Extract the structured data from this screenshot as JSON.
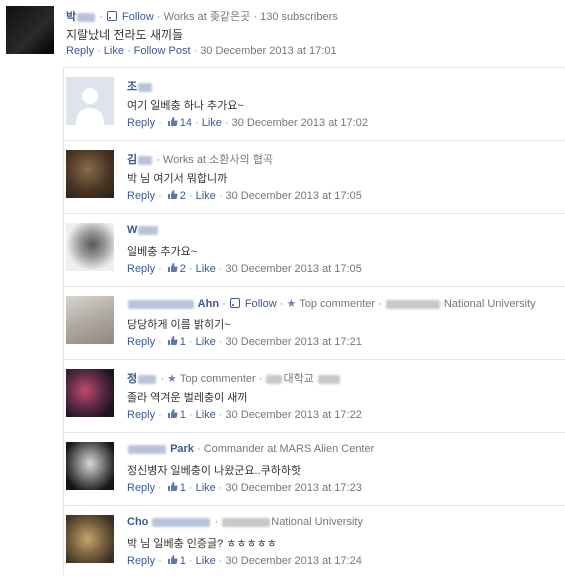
{
  "post": {
    "author_prefix": "박",
    "follow_label": "Follow",
    "work_info": "· Works at 좆같은곳 ·",
    "subscribers": "130 subscribers",
    "text": "지랄났네 전라도 새끼들",
    "actions": {
      "reply": "Reply",
      "like": "Like",
      "follow_post": "Follow Post",
      "timestamp": "30 December 2013 at 17:01"
    }
  },
  "replies": [
    {
      "name_prefix": "조",
      "name_suffix": "",
      "info": "",
      "text": "여기 일베충 하나 추가요~",
      "reply": "Reply",
      "likes": "14",
      "like": "Like",
      "timestamp": "30 December 2013 at 17:02"
    },
    {
      "name_prefix": "김",
      "name_suffix": "",
      "info": "· Works at 소환사의 협곡",
      "text": "박      님 여기서 뭐합니까",
      "reply": "Reply",
      "likes": "2",
      "like": "Like",
      "timestamp": "30 December 2013 at 17:05"
    },
    {
      "name_prefix": "W",
      "name_suffix": "",
      "info": "",
      "text": "일베충 추가요~",
      "reply": "Reply",
      "likes": "2",
      "like": "Like",
      "timestamp": "30 December 2013 at 17:05"
    },
    {
      "name_prefix": "",
      "name_suffix": "Ahn",
      "follow_label": "Follow",
      "top_commenter": "Top commenter",
      "info": "National University",
      "text": "당당하게 이름 밝히기~",
      "reply": "Reply",
      "likes": "1",
      "like": "Like",
      "timestamp": "30 December 2013 at 17:21"
    },
    {
      "name_prefix": "정",
      "name_suffix": "",
      "top_commenter": "Top commenter",
      "info": "대학교",
      "text": "졸라 역겨운 벌레충이 새끼",
      "reply": "Reply",
      "likes": "1",
      "like": "Like",
      "timestamp": "30 December 2013 at 17:22"
    },
    {
      "name_prefix": "",
      "name_suffix": "Park",
      "info": "· Commander at MARS Alien Center",
      "text": "정신병자 일베충이 나왔군요..쿠하하핫",
      "reply": "Reply",
      "likes": "1",
      "like": "Like",
      "timestamp": "30 December 2013 at 17:23"
    },
    {
      "name_prefix": "Cho",
      "name_suffix": "",
      "info": "National University",
      "text": "박      님 일베충 인증글? ㅎㅎㅎㅎㅎ",
      "reply": "Reply",
      "likes": "1",
      "like": "Like",
      "timestamp": "30 December 2013 at 17:24"
    }
  ],
  "colors": {
    "link": "#3b5998",
    "meta": "#777777",
    "text": "#333333",
    "divider": "#e6e6e6"
  },
  "icons": {
    "follow": "rss-icon",
    "like": "thumbs-up-icon",
    "top_commenter": "star-icon"
  }
}
